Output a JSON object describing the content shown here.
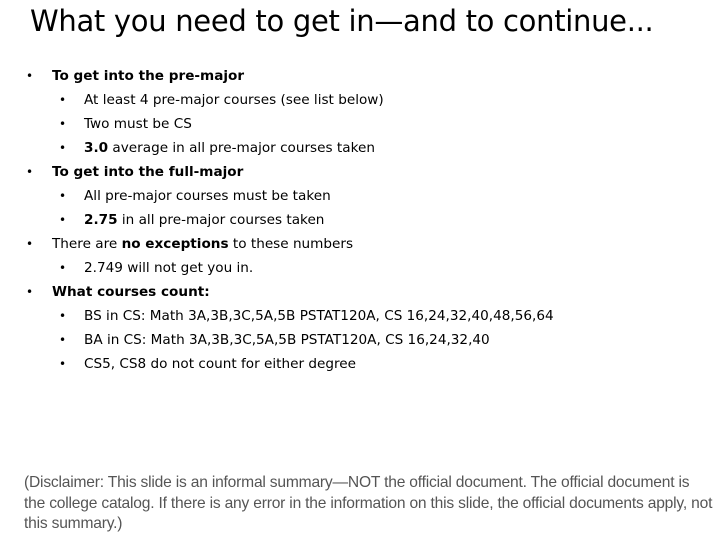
{
  "title": "What you need to get in—and to continue...",
  "bullet_glyph": "•",
  "sections": [
    {
      "heading_bold": "To get into the pre-major",
      "items": [
        {
          "pre": "",
          "bold": "",
          "text": "At least 4 pre-major courses (see list below)"
        },
        {
          "pre": "",
          "bold": "",
          "text": "Two must be CS"
        },
        {
          "pre": "",
          "bold": "3.0",
          "text": " average in all pre-major courses taken"
        }
      ]
    },
    {
      "heading_bold": "To get into the full-major",
      "items": [
        {
          "pre": "",
          "bold": "",
          "text": "All pre-major courses must be taken"
        },
        {
          "pre": "",
          "bold": "2.75",
          "text": " in all pre-major courses taken"
        }
      ]
    },
    {
      "heading_pre": "There are ",
      "heading_mid_bold": "no exceptions",
      "heading_post": " to these numbers",
      "items": [
        {
          "pre": "",
          "bold": "",
          "text": "2.749 will not get you in."
        }
      ]
    },
    {
      "heading_bold": "What courses count:",
      "items": [
        {
          "pre": "",
          "bold": "",
          "text": "BS in CS: Math 3A,3B,3C,5A,5B PSTAT120A, CS 16,24,32,40,48,56,64"
        },
        {
          "pre": "",
          "bold": "",
          "text": "BA in CS: Math 3A,3B,3C,5A,5B PSTAT120A, CS 16,24,32,40"
        },
        {
          "pre": "",
          "bold": "",
          "text": "CS5, CS8 do not count for either degree"
        }
      ]
    }
  ],
  "disclaimer": "(Disclaimer: This slide is an informal summary—NOT the official document. The official document is the college catalog. If there is any error in the information on this slide, the official documents apply, not this summary.)",
  "colors": {
    "text": "#000000",
    "disclaimer": "#555555",
    "background": "#ffffff"
  }
}
